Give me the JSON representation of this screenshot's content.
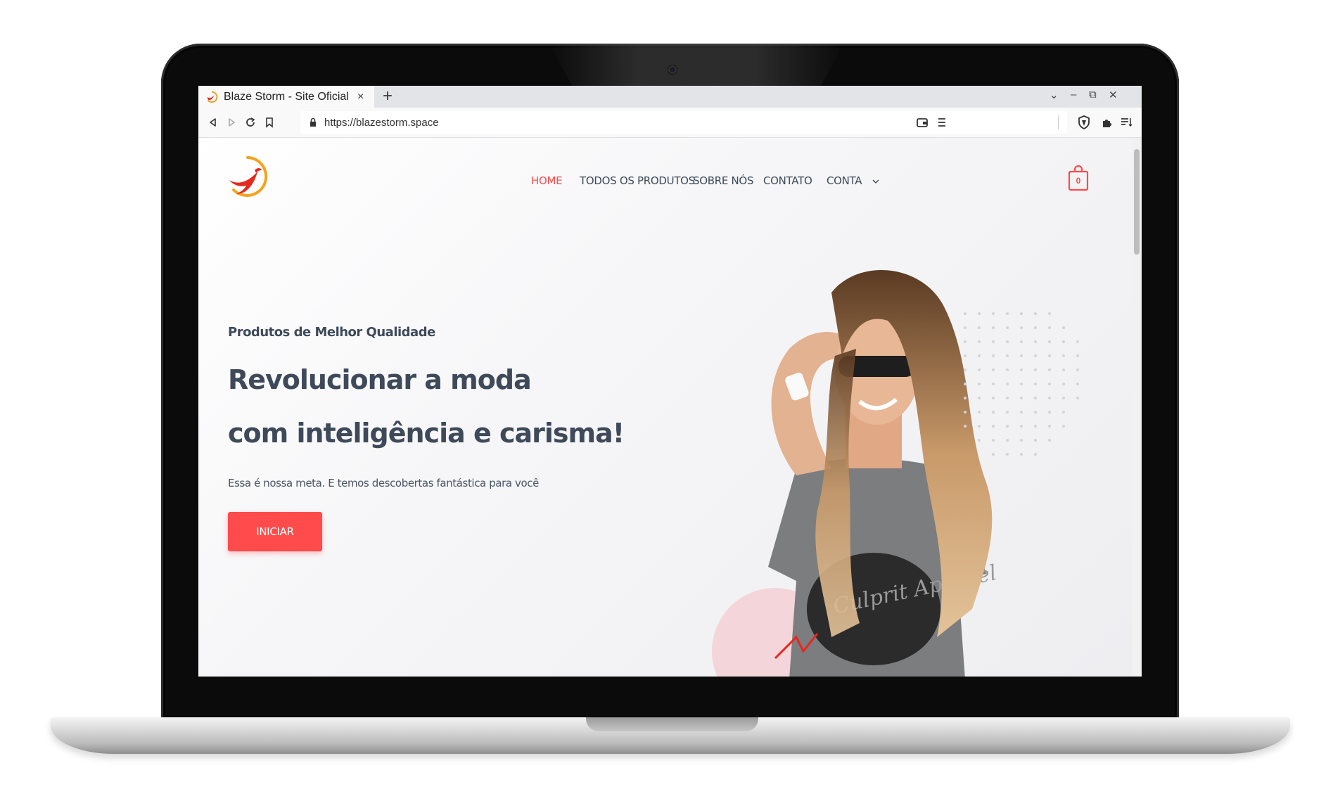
{
  "browser": {
    "tab_title": "Blaze Storm - Site Oficial",
    "tab_close": "×",
    "new_tab": "+",
    "url": "https://blazestorm.space",
    "window_controls": [
      "⌄",
      "–",
      "⧉",
      "✕"
    ]
  },
  "nav": {
    "items": [
      {
        "label": "HOME",
        "active": true
      },
      {
        "label": "TODOS OS PRODUTOS",
        "active": false
      },
      {
        "label": "SOBRE NÓS",
        "active": false
      },
      {
        "label": "CONTATO",
        "active": false
      },
      {
        "label": "CONTA",
        "active": false
      }
    ],
    "cart_count": "0"
  },
  "hero": {
    "subtitle": "Produtos de Melhor Qualidade",
    "title_line1": "Revolucionar a moda",
    "title_line2": "com inteligência e carisma!",
    "description": "Essa é nossa meta. E temos descobertas fantástica para você",
    "cta_label": "INICIAR",
    "shirt_text": "Culprit Apparel"
  },
  "colors": {
    "accent": "#ff4b4b",
    "text": "#3e4a59",
    "laptop_bezel": "#0b0b0b"
  },
  "icons": [
    "back-icon",
    "forward-icon",
    "reload-icon",
    "bookmark-icon",
    "lock-icon",
    "shield-icon",
    "extensions-icon",
    "reading-list-icon",
    "wallet-icon",
    "menu-icon",
    "chevron-down-icon",
    "cart-icon",
    "logo-phoenix"
  ]
}
